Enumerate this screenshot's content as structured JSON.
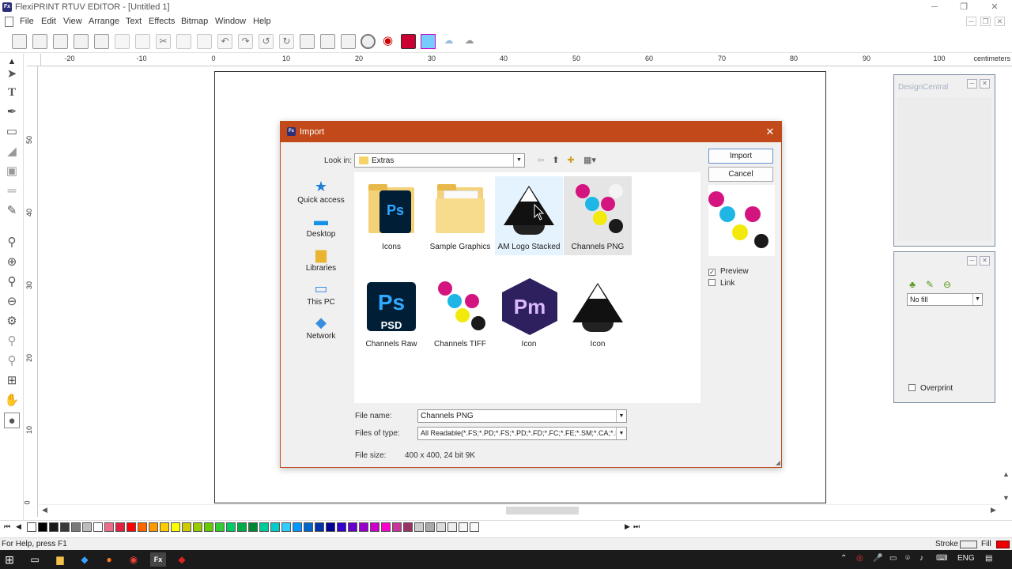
{
  "window": {
    "title": "FlexiPRINT RTUV EDITOR - [Untitled 1]",
    "app_icon": "Fx",
    "controls": [
      "minimize-icon",
      "restore-icon",
      "close-icon"
    ],
    "control_glyphs": [
      "─",
      "❐",
      "✕"
    ]
  },
  "menu": {
    "items": [
      "File",
      "Edit",
      "View",
      "Arrange",
      "Text",
      "Effects",
      "Bitmap",
      "Window",
      "Help"
    ],
    "mdi_glyphs": [
      "─",
      "❐",
      "✕"
    ]
  },
  "ruler": {
    "unit": "centimeters",
    "h_labels": [
      "-20",
      "-10",
      "0",
      "10",
      "20",
      "30",
      "40",
      "50",
      "60",
      "70",
      "80",
      "90",
      "100"
    ],
    "v_labels": [
      "50",
      "40",
      "30",
      "20",
      "10",
      "0"
    ]
  },
  "dialog": {
    "icon": "Fx",
    "title": "Import",
    "close_glyph": "✕",
    "look_in_label": "Look in:",
    "look_in_value": "Extras",
    "places": [
      {
        "label": "Quick access",
        "icon": "star-icon",
        "glyph": "★",
        "color": "#1e7fd6"
      },
      {
        "label": "Desktop",
        "icon": "desktop-icon",
        "glyph": "▬",
        "color": "#1591e8"
      },
      {
        "label": "Libraries",
        "icon": "libraries-icon",
        "glyph": "▆",
        "color": "#e9b431"
      },
      {
        "label": "This PC",
        "icon": "computer-icon",
        "glyph": "▭",
        "color": "#3a8ee0"
      },
      {
        "label": "Network",
        "icon": "network-icon",
        "glyph": "◆",
        "color": "#3a8ee0"
      }
    ],
    "files": [
      {
        "name": "Icons",
        "kind": "folder-ps"
      },
      {
        "name": "Sample Graphics",
        "kind": "folder"
      },
      {
        "name": "AM Logo Stacked",
        "kind": "mountain"
      },
      {
        "name": "Channels PNG",
        "kind": "dots"
      },
      {
        "name": "Channels Raw",
        "kind": "psd"
      },
      {
        "name": "Channels TIFF",
        "kind": "dots"
      },
      {
        "name": "Icon",
        "kind": "pm"
      },
      {
        "name": "Icon",
        "kind": "mountain"
      }
    ],
    "selected_file": "Channels PNG",
    "hovered_file": "AM Logo Stacked",
    "import_label": "Import",
    "cancel_label": "Cancel",
    "preview_label": "Preview",
    "preview_checked": true,
    "link_label": "Link",
    "link_checked": false,
    "file_name_label": "File name:",
    "file_name_value": "Channels PNG",
    "file_type_label": "Files of type:",
    "file_type_value": "All Readable(*.FS;*.PD;*.FS;*.PD;*.FD;*.FC;*.FE;*.SM;*.CA;*.Pl",
    "file_size_label": "File size:",
    "file_size_value": "400 x 400, 24 bit 9K",
    "dot_colors": {
      "magenta": "#d4157f",
      "cyan": "#1fb6e6",
      "yellow": "#f2ea0c",
      "black": "#1a1a1a"
    }
  },
  "panels": {
    "design_central": {
      "title": "DesignCentral"
    },
    "fill": {
      "value": "No fill",
      "overprint_label": "Overprint",
      "overprint_checked": false
    }
  },
  "status": {
    "help": "For Help, press F1",
    "stroke_label": "Stroke",
    "fill_label": "Fill",
    "fill_color": "#e00000"
  },
  "taskbar": {
    "language": "ENG"
  },
  "palette": [
    "#000000",
    "#1a1a1a",
    "#3a3a3a",
    "#7a7a7a",
    "#bdbdbd",
    "#ffffff",
    "#f06b8a",
    "#e0213f",
    "#ff0000",
    "#ff6600",
    "#ff9900",
    "#ffcc00",
    "#ffff00",
    "#cccc00",
    "#99cc00",
    "#66cc00",
    "#33cc33",
    "#00cc66",
    "#00aa44",
    "#008833",
    "#00cc99",
    "#00cccc",
    "#33ccff",
    "#0099ff",
    "#0066cc",
    "#0033aa",
    "#000099",
    "#3300cc",
    "#6600cc",
    "#9900cc",
    "#cc00cc",
    "#ff00cc",
    "#cc3399",
    "#993366",
    "#cccccc",
    "#aaaaaa",
    "#dddddd",
    "#eeeeee",
    "#f5f5f5",
    "#fafafa"
  ]
}
